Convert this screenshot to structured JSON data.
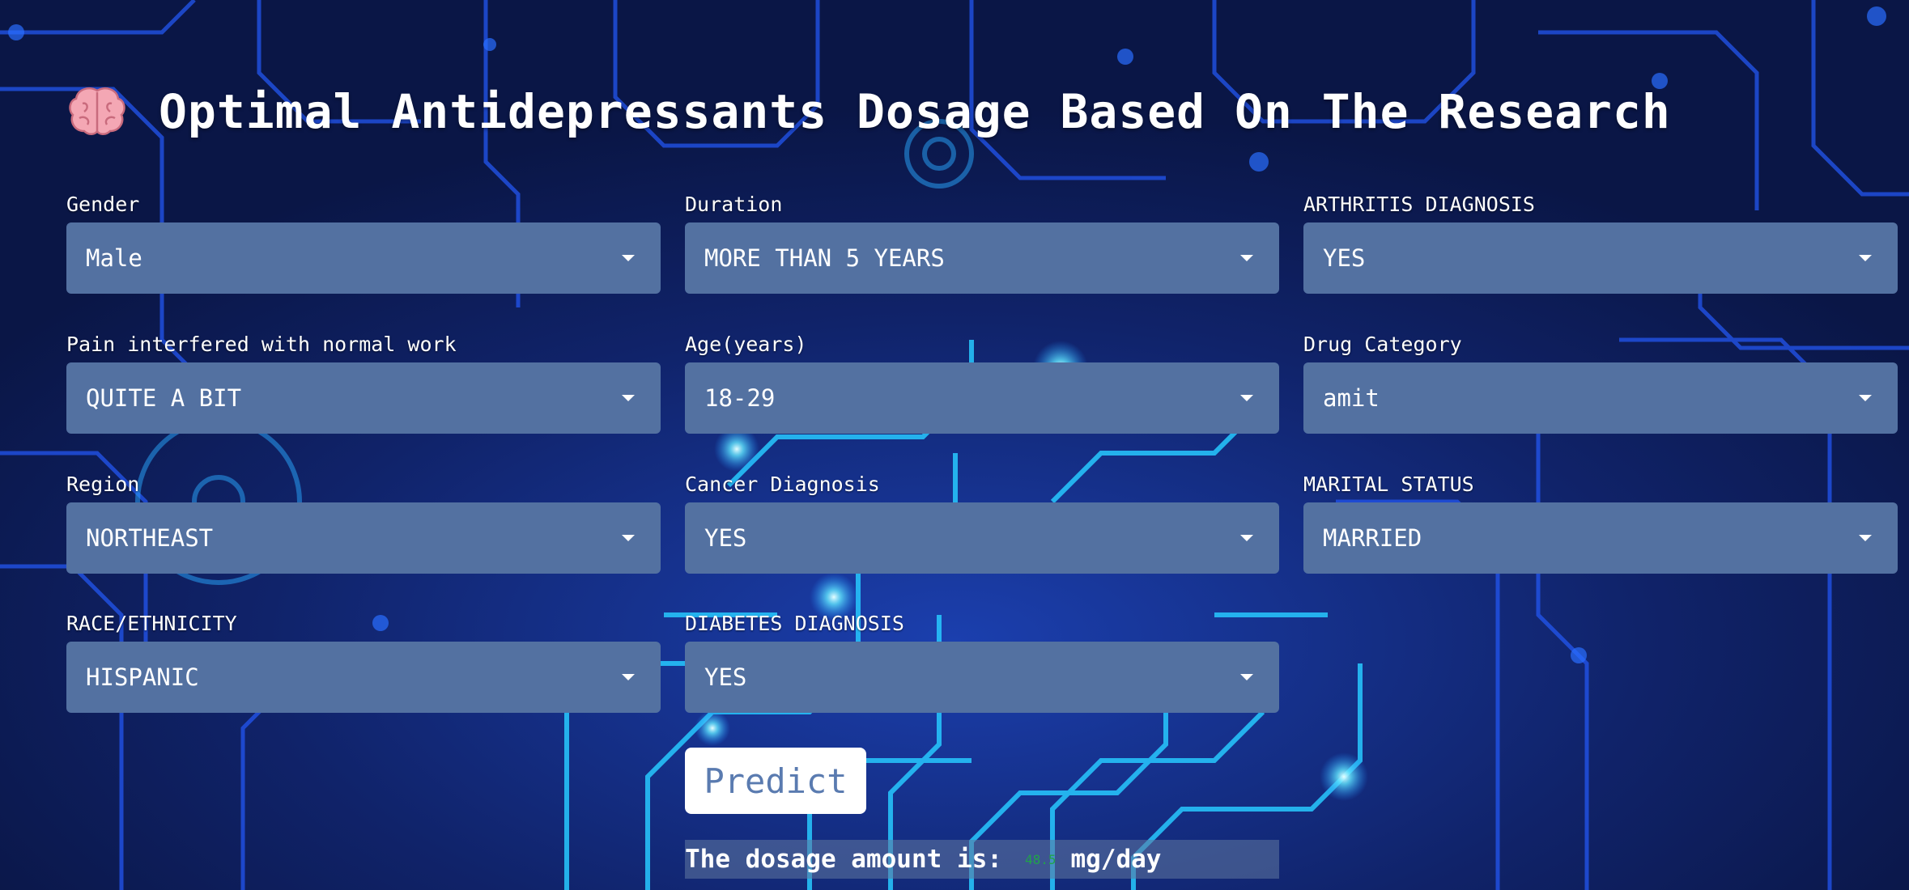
{
  "page": {
    "title": "Optimal Antidepressants Dosage Based On The Research",
    "title_icon": "brain-icon"
  },
  "colors": {
    "background": "#0c1a52",
    "circuit": "#1f59ff",
    "circuit_glow": "#29d6ff",
    "select_bg": "#5371a1",
    "button_text": "#5a7bb0",
    "result_value": "#21a34a"
  },
  "form": {
    "gender": {
      "label": "Gender",
      "value": "Male"
    },
    "duration": {
      "label": "Duration",
      "value": "MORE THAN 5 YEARS"
    },
    "arthritis": {
      "label": "ARTHRITIS DIAGNOSIS",
      "value": "YES"
    },
    "pain": {
      "label": "Pain interfered with normal work",
      "value": "QUITE A BIT"
    },
    "age": {
      "label": "Age(years)",
      "value": "18-29"
    },
    "drug_category": {
      "label": "Drug Category",
      "value": "amit"
    },
    "region": {
      "label": "Region",
      "value": "NORTHEAST"
    },
    "cancer": {
      "label": "Cancer Diagnosis",
      "value": "YES"
    },
    "marital_status": {
      "label": "MARITAL STATUS",
      "value": "MARRIED"
    },
    "race": {
      "label": "RACE/ETHNICITY",
      "value": "HISPANIC"
    },
    "diabetes": {
      "label": "DIABETES DIAGNOSIS",
      "value": "YES"
    }
  },
  "actions": {
    "predict_label": "Predict"
  },
  "result": {
    "prefix": "The dosage amount is:",
    "value": "48.5",
    "unit": "mg/day"
  }
}
